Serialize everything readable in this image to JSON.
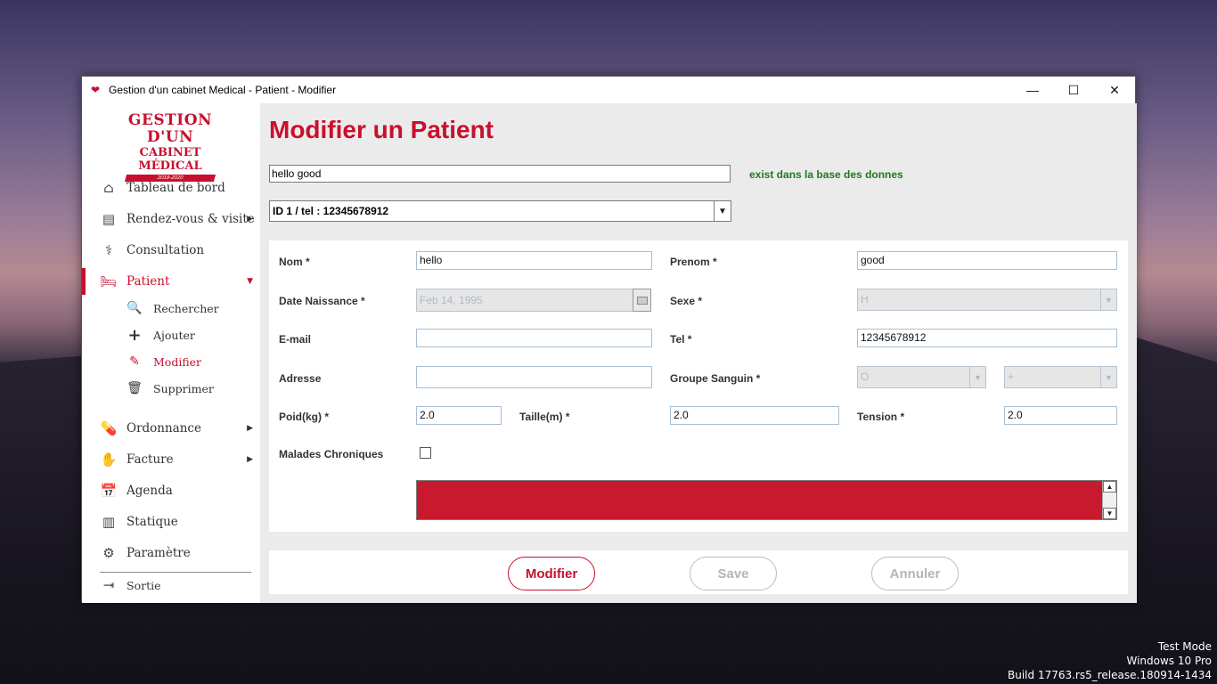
{
  "window": {
    "title": "Gestion d'un cabinet Medical - Patient - Modifier",
    "controls": {
      "minimize": "—",
      "maximize": "☐",
      "close": "✕"
    }
  },
  "logo": {
    "line1": "GESTION D'UN",
    "line2": "CABINET MÉDICAL",
    "line3": "2019-2020"
  },
  "sidebar": {
    "items": [
      {
        "label": "Tableau de bord",
        "icon": "home-icon",
        "glyph": "⌂"
      },
      {
        "label": "Rendez-vous & visite",
        "icon": "document-icon",
        "glyph": "▤",
        "arrow": "▶"
      },
      {
        "label": "Consultation",
        "icon": "stethoscope-icon",
        "glyph": "⚕"
      },
      {
        "label": "Patient",
        "icon": "bed-icon",
        "glyph": "🛏",
        "arrow": "▼"
      },
      {
        "label": "Ordonnance",
        "icon": "pill-icon",
        "glyph": "💊",
        "arrow": "▶"
      },
      {
        "label": "Facture",
        "icon": "hand-money-icon",
        "glyph": "✋",
        "arrow": "▶"
      },
      {
        "label": "Agenda",
        "icon": "calendar-icon",
        "glyph": "📅"
      },
      {
        "label": "Statique",
        "icon": "bar-chart-icon",
        "glyph": "▥"
      },
      {
        "label": "Paramètre",
        "icon": "gear-icon",
        "glyph": "⚙"
      },
      {
        "label": "Sortie",
        "icon": "exit-icon",
        "glyph": "⇥"
      }
    ],
    "sub_items": [
      {
        "label": "Rechercher",
        "icon": "search-icon",
        "glyph": "🔍"
      },
      {
        "label": "Ajouter",
        "icon": "plus-icon",
        "glyph": "+"
      },
      {
        "label": "Modifier",
        "icon": "pencil-icon",
        "glyph": "✎"
      },
      {
        "label": "Supprimer",
        "icon": "trash-icon",
        "glyph": "🗑"
      }
    ]
  },
  "main": {
    "title": "Modifier un Patient",
    "search_value": "hello good",
    "exist_message": "exist dans la base des donnes",
    "patient_select": "ID 1 / tel : 12345678912",
    "combo_arrow": "▼"
  },
  "form": {
    "nom_label": "Nom *",
    "nom_value": "hello",
    "prenom_label": "Prenom *",
    "prenom_value": "good",
    "date_label": "Date Naissance *",
    "date_value": "Feb 14, 1995",
    "sexe_label": "Sexe *",
    "sexe_value": "H",
    "email_label": "E-mail",
    "email_value": "",
    "tel_label": "Tel *",
    "tel_value": "12345678912",
    "adresse_label": "Adresse",
    "adresse_value": "",
    "groupe_label": "Groupe Sanguin *",
    "groupe_value": "O",
    "rh_value": "+",
    "poid_label": "Poid(kg) *",
    "poid_value": "2.0",
    "taille_label": "Taille(m) *",
    "taille_value": "2.0",
    "tension_label": "Tension *",
    "tension_value": "2.0",
    "malades_label": "Malades Chroniques",
    "scroll_up": "▲",
    "scroll_down": "▼"
  },
  "buttons": {
    "modifier": "Modifier",
    "save": "Save",
    "annuler": "Annuler"
  },
  "colors": {
    "accent": "#c8102e",
    "success": "#1e7a1e"
  },
  "os_watermark": [
    "Test Mode",
    "Windows 10 Pro",
    "Build 17763.rs5_release.180914-1434"
  ]
}
